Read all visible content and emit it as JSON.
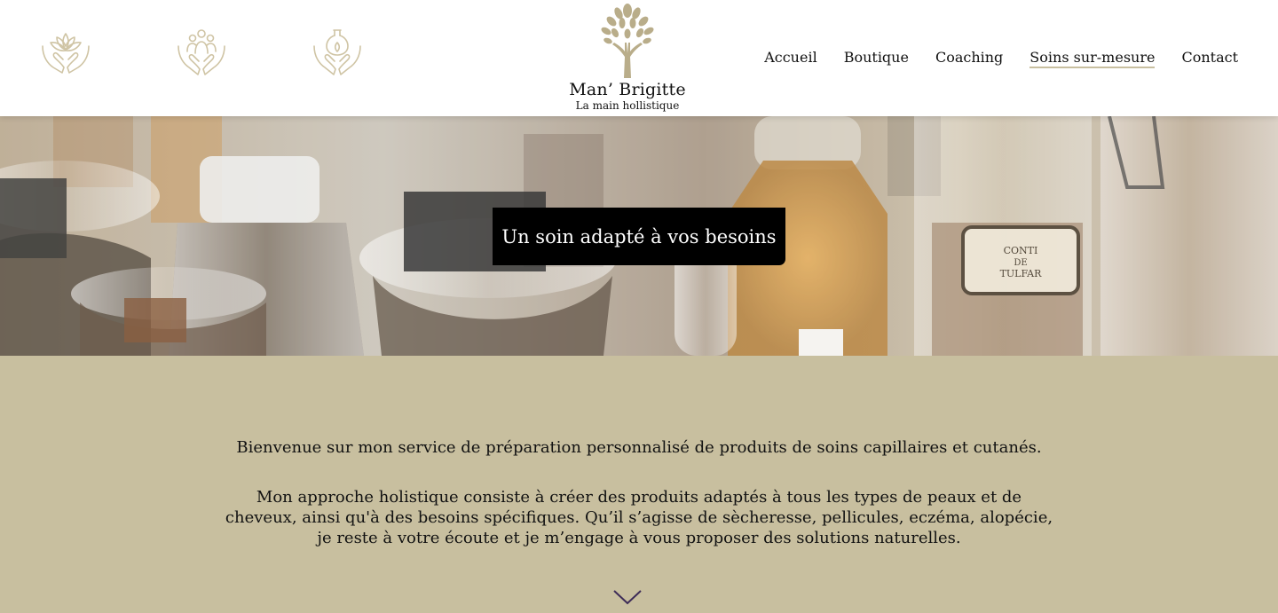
{
  "header": {
    "icons": [
      "hands-lotus-icon",
      "hands-people-icon",
      "hands-flask-icon"
    ],
    "logo": {
      "name": "Man’ Brigitte",
      "tagline": "La main hollistique",
      "icon": "tree-hand-icon"
    },
    "nav": [
      {
        "label": "Accueil",
        "active": false
      },
      {
        "label": "Boutique",
        "active": false
      },
      {
        "label": "Coaching",
        "active": false
      },
      {
        "label": "Soins sur-mesure",
        "active": true
      },
      {
        "label": "Contact",
        "active": false
      }
    ]
  },
  "hero": {
    "cta_label": "Un soin adapté à vos besoins",
    "jar_label_lines": [
      "CONTI",
      "DE",
      "TULFAR"
    ]
  },
  "intro": {
    "paragraph1": "Bienvenue sur mon service de préparation personnalisé de produits de soins capillaires et cutanés.",
    "paragraph2_lines": [
      "Mon approche holistique consiste à créer des produits adaptés à tous les types de peaux et de",
      "cheveux, ainsi qu'à des besoins spécifiques. Qu’il s’agisse de sècheresse, pellicules, eczéma, alopécie,",
      "je reste à votre écoute et je m’engage à vous proposer des solutions naturelles."
    ],
    "scroll_icon": "chevron-down-icon"
  },
  "colors": {
    "accent_gold": "#c8bf9f",
    "icon_stroke": "#cfc4a4",
    "cta_bg": "#000000",
    "chevron": "#3d2b57"
  }
}
